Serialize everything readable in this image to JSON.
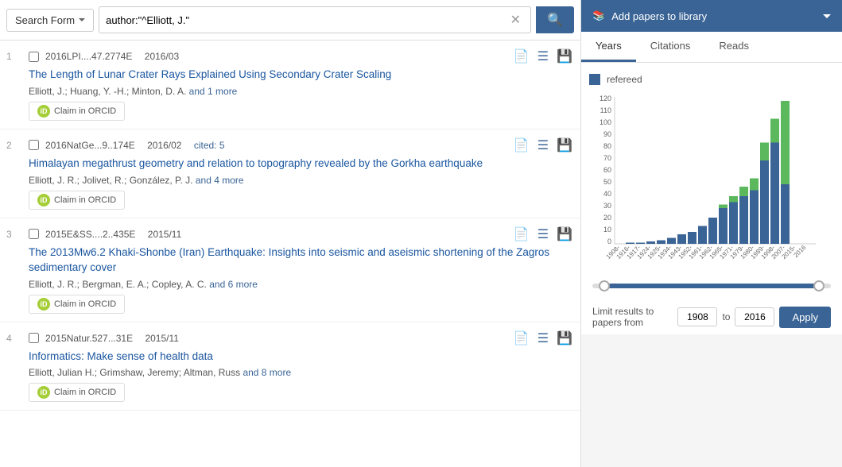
{
  "searchBar": {
    "formButtonLabel": "Search Form",
    "inputValue": "author:\"^Elliott, J.\"",
    "searchButtonTitle": "Search"
  },
  "results": [
    {
      "num": "1",
      "bibcode": "2016LPI....47.2774E",
      "date": "2016/03",
      "cited": "",
      "title": "The Length of Lunar Crater Rays Explained Using Secondary Crater Scaling",
      "authors": "Elliott, J.;  Huang, Y. -H.;  Minton, D. A.",
      "moreAuthors": "and 1 more",
      "claimLabel": "Claim in ORCID"
    },
    {
      "num": "2",
      "bibcode": "2016NatGe...9..174E",
      "date": "2016/02",
      "cited": "cited: 5",
      "title": "Himalayan megathrust geometry and relation to topography revealed by the Gorkha earthquake",
      "authors": "Elliott, J. R.;  Jolivet, R.;  González, P. J.",
      "moreAuthors": "and 4 more",
      "claimLabel": "Claim in ORCID"
    },
    {
      "num": "3",
      "bibcode": "2015E&SS....2..435E",
      "date": "2015/11",
      "cited": "",
      "title": "The 2013Mw6.2 Khaki-Shonbe (Iran) Earthquake: Insights into seismic and aseismic shortening of the Zagros sedimentary cover",
      "authors": "Elliott, J. R.;  Bergman, E. A.;  Copley, A. C.",
      "moreAuthors": "and 6 more",
      "claimLabel": "Claim in ORCID"
    },
    {
      "num": "4",
      "bibcode": "2015Natur.527...31E",
      "date": "2015/11",
      "cited": "",
      "title": "Informatics: Make sense of health data",
      "authors": "Elliott, Julian H.;  Grimshaw, Jeremy;  Altman, Russ",
      "moreAuthors": "and 8 more",
      "claimLabel": "Claim in ORCID"
    }
  ],
  "rightPanel": {
    "addPapersLabel": "Add papers to library",
    "tabs": [
      "Years",
      "Citations",
      "Reads"
    ],
    "activeTab": 0,
    "legendLabel": "refereed",
    "yAxisLabels": [
      "10",
      "20",
      "30",
      "40",
      "50",
      "60",
      "70",
      "80",
      "90",
      "100",
      "110",
      "120"
    ],
    "xLabels": [
      "1908-",
      "1916-",
      "1917-",
      "1924-",
      "1925-",
      "1934-",
      "1943-",
      "1952-",
      "1961-",
      "1962-",
      "1965-",
      "1971-",
      "1979-",
      "1980-",
      "1989-",
      "1998-",
      "2007-",
      "2015-",
      "2016"
    ],
    "bars": [
      {
        "blue": 0,
        "green": 0
      },
      {
        "blue": 0,
        "green": 0
      },
      {
        "blue": 1,
        "green": 0
      },
      {
        "blue": 1,
        "green": 0
      },
      {
        "blue": 2,
        "green": 0
      },
      {
        "blue": 3,
        "green": 0
      },
      {
        "blue": 5,
        "green": 0
      },
      {
        "blue": 8,
        "green": 0
      },
      {
        "blue": 10,
        "green": 0
      },
      {
        "blue": 15,
        "green": 0
      },
      {
        "blue": 22,
        "green": 0
      },
      {
        "blue": 30,
        "green": 3
      },
      {
        "blue": 35,
        "green": 5
      },
      {
        "blue": 40,
        "green": 8
      },
      {
        "blue": 45,
        "green": 10
      },
      {
        "blue": 70,
        "green": 15
      },
      {
        "blue": 85,
        "green": 20
      },
      {
        "blue": 50,
        "green": 70
      },
      {
        "blue": 0,
        "green": 0
      }
    ],
    "maxVal": 120,
    "limitLabel": "Limit results to papers from",
    "fromYear": "1908",
    "toLabel": "to",
    "toYear": "2016",
    "applyLabel": "Apply"
  }
}
